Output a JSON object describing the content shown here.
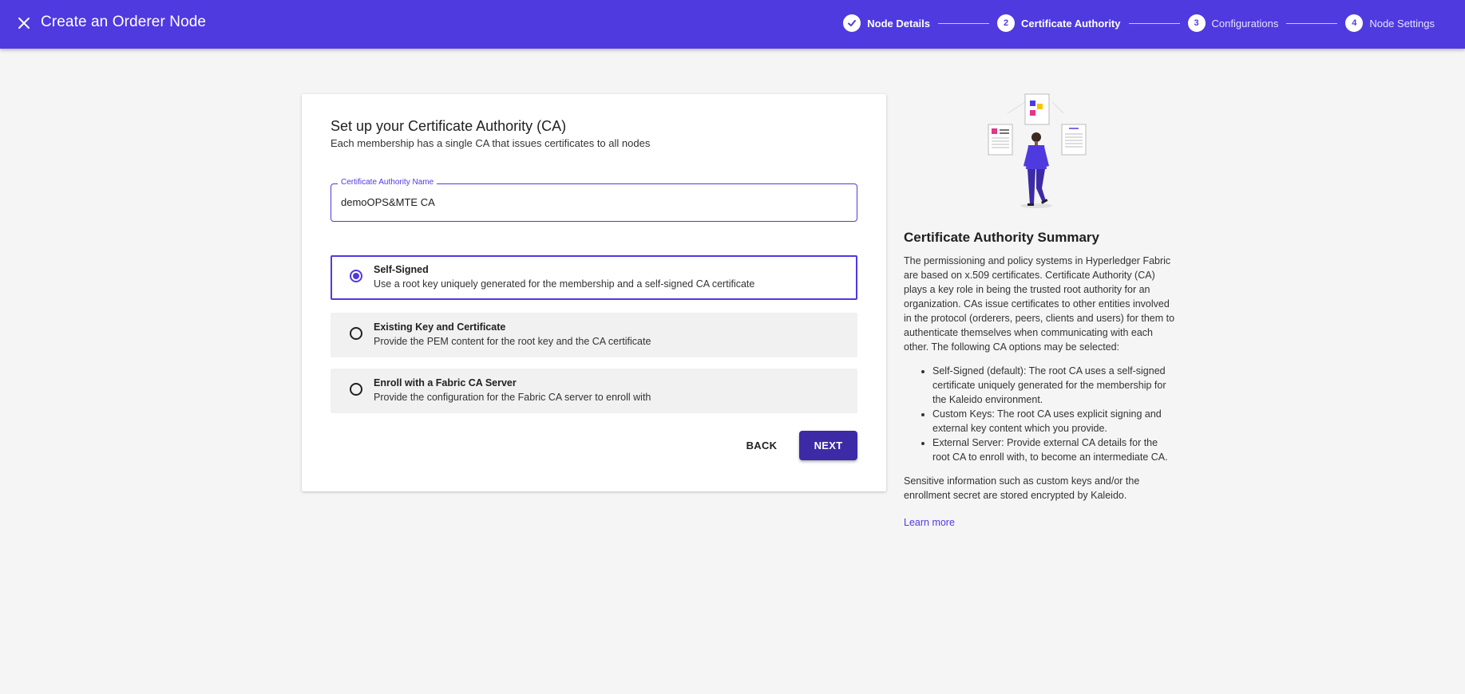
{
  "header": {
    "title": "Create an Orderer Node",
    "steps": [
      {
        "number": "1",
        "label": "Node Details",
        "state": "done"
      },
      {
        "number": "2",
        "label": "Certificate Authority",
        "state": "active"
      },
      {
        "number": "3",
        "label": "Configurations",
        "state": "pending"
      },
      {
        "number": "4",
        "label": "Node Settings",
        "state": "pending"
      }
    ]
  },
  "card": {
    "title": "Set up your Certificate Authority (CA)",
    "subtitle": "Each membership has a single CA that issues certificates to all nodes",
    "field": {
      "label": "Certificate Authority Name",
      "value": "demoOPS&MTE CA"
    },
    "options": [
      {
        "title": "Self-Signed",
        "description": "Use a root key uniquely generated for the membership and a self-signed CA certificate",
        "selected": true
      },
      {
        "title": "Existing Key and Certificate",
        "description": "Provide the PEM content for the root key and the CA certificate",
        "selected": false
      },
      {
        "title": "Enroll with a Fabric CA Server",
        "description": "Provide the configuration for the Fabric CA server to enroll with",
        "selected": false
      }
    ],
    "back_label": "BACK",
    "next_label": "NEXT"
  },
  "summary": {
    "title": "Certificate Authority Summary",
    "intro": "The permissioning and policy systems in Hyperledger Fabric are based on x.509 certificates. Certificate Authority (CA) plays a key role in being the trusted root authority for an organization. CAs issue certificates to other entities involved in the protocol (orderers, peers, clients and users) for them to authenticate themselves when communicating with each other. The following CA options may be selected:",
    "bullets": [
      "Self-Signed (default): The root CA uses a self-signed certificate uniquely generated for the membership for the Kaleido environment.",
      "Custom Keys: The root CA uses explicit signing and external key content which you provide.",
      "External Server: Provide external CA details for the root CA to enroll with, to become an intermediate CA."
    ],
    "note": "Sensitive information such as custom keys and/or the enrollment secret are stored encrypted by Kaleido.",
    "learn_more": "Learn more"
  },
  "colors": {
    "primary": "#4f3ae0",
    "button": "#3c2aa6",
    "background": "#f5f5f5"
  }
}
